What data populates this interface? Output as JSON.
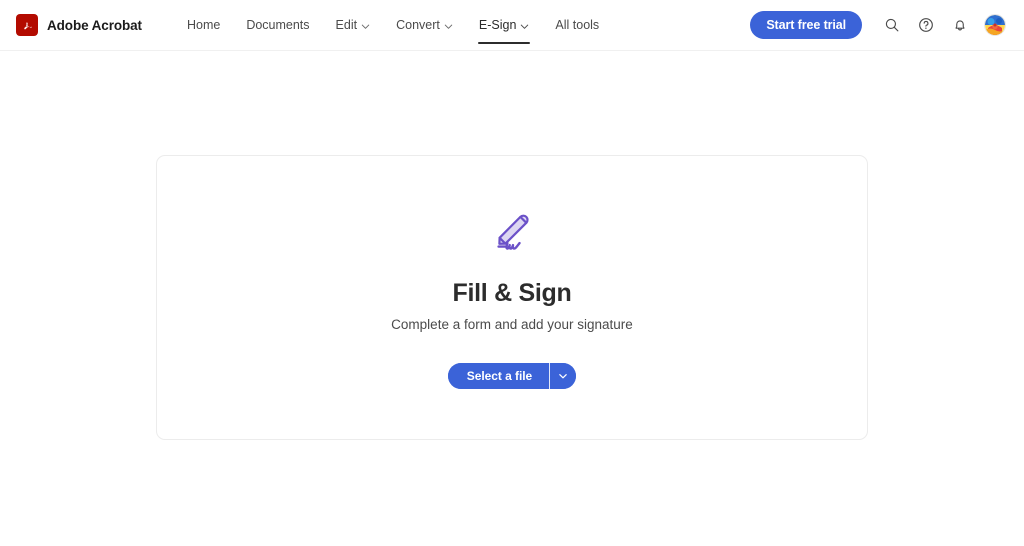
{
  "app": {
    "brand_name": "Adobe Acrobat",
    "logo_icon": "adobe-acrobat-logo",
    "accent_blue": "#3b63d8",
    "logo_red": "#b30b00",
    "tool_icon_purple": "#6b51c8"
  },
  "topnav": {
    "items": [
      {
        "label": "Home",
        "has_caret": false,
        "active": false,
        "name": "home"
      },
      {
        "label": "Documents",
        "has_caret": false,
        "active": false,
        "name": "documents"
      },
      {
        "label": "Edit",
        "has_caret": true,
        "active": false,
        "name": "edit"
      },
      {
        "label": "Convert",
        "has_caret": true,
        "active": false,
        "name": "convert"
      },
      {
        "label": "E-Sign",
        "has_caret": true,
        "active": true,
        "name": "e-sign"
      },
      {
        "label": "All tools",
        "has_caret": false,
        "active": false,
        "name": "all-tools"
      }
    ],
    "trial_button_label": "Start free trial",
    "icons": [
      {
        "name": "search-icon",
        "label": "Search"
      },
      {
        "name": "help-icon",
        "label": "Help"
      },
      {
        "name": "notifications-bell-icon",
        "label": "Notifications"
      }
    ],
    "avatar_name": "user-avatar"
  },
  "tool_card": {
    "icon_name": "fill-and-sign-icon",
    "title": "Fill & Sign",
    "subtitle": "Complete a form and add your signature",
    "primary_button_label": "Select a file",
    "dropdown_icon": "chevron-down-icon"
  }
}
